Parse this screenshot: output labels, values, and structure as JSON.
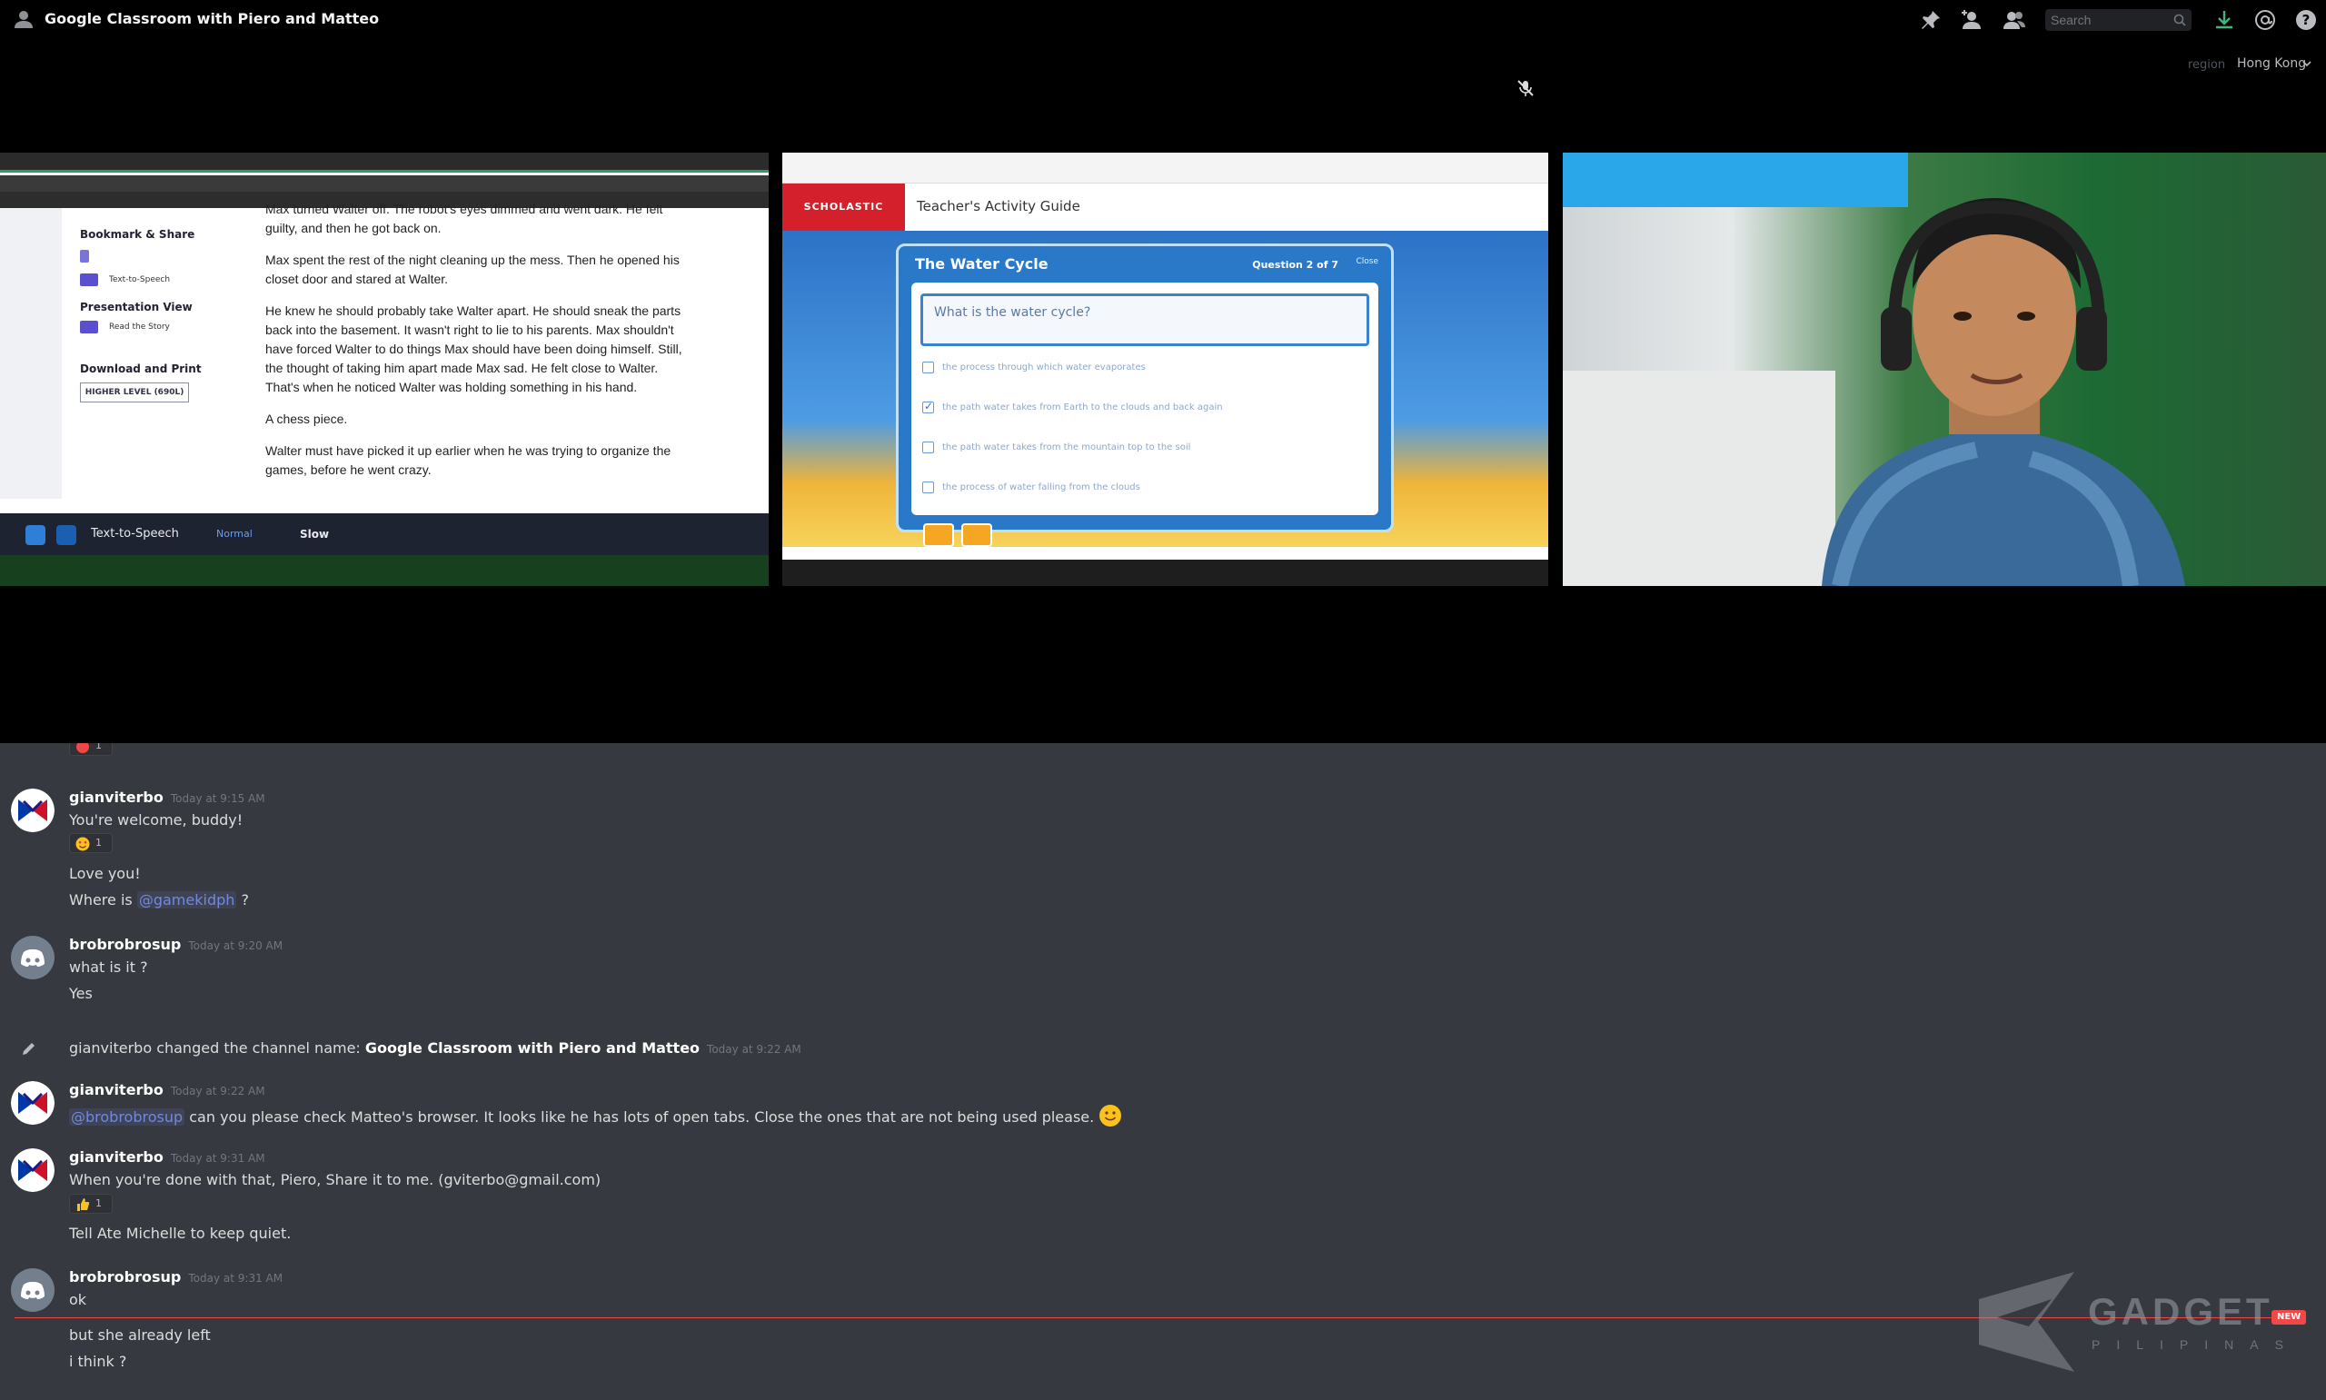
{
  "header": {
    "channel_title": "Google Classroom with Piero and Matteo",
    "search_placeholder": "Search",
    "icons": [
      "pin-icon",
      "add-member-icon",
      "member-list-icon",
      "search-icon",
      "download-icon",
      "mention-icon",
      "help-icon"
    ]
  },
  "voice": {
    "region_label": "region",
    "region_value": "Hong Kong"
  },
  "tile_book": {
    "sidebar_bookmark": "Bookmark & Share",
    "sidebar_tts": "Text-to-Speech",
    "sidebar_presentation": "Presentation View",
    "sidebar_read": "Read the Story",
    "sidebar_download": "Download and Print",
    "level_button": "HIGHER LEVEL (690L)",
    "paragraphs": [
      "Max turned Walter off. The robot's eyes dimmed and went dark. He felt guilty, and then he got back on.",
      "Max spent the rest of the night cleaning up the mess. Then he opened his closet door and stared at Walter.",
      "He knew he should probably take Walter apart. He should sneak the parts back into the basement. It wasn't right to lie to his parents. Max shouldn't have forced Walter to do things Max should have been doing himself. Still, the thought of taking him apart made Max sad. He felt close to Walter. That's when he noticed Walter was holding something in his hand.",
      "A chess piece.",
      "Walter must have picked it up earlier when he was trying to organize the games, before he went crazy."
    ],
    "tts_label": "Text-to-Speech",
    "tts_option_1": "Normal",
    "tts_option_2": "Slow"
  },
  "tile_quiz": {
    "brand": "SCHOLASTIC",
    "guide_title": "Teacher's Activity Guide",
    "quiz_title": "The Water Cycle",
    "question_number": "Question 2 of 7",
    "close_label": "Close",
    "question": "What is the water cycle?",
    "options": [
      {
        "text": "the process through which water evaporates",
        "checked": false
      },
      {
        "text": "the path water takes from Earth to the clouds and back again",
        "checked": true
      },
      {
        "text": "the path water takes from the mountain top to the soil",
        "checked": false
      },
      {
        "text": "the process of water falling from the clouds",
        "checked": false
      }
    ]
  },
  "tile_cam": {
    "subject": "webcam-video"
  },
  "chat": {
    "messages": [
      {
        "author": "gianviterbo",
        "timestamp": "Today at 9:15 AM",
        "avatar": "gianviterbo-avatar",
        "lines": [
          "You're welcome, buddy!",
          "Love you!",
          "Where is",
          "@gamekidph",
          "?"
        ],
        "reaction_count": "1"
      },
      {
        "author": "brobrobrosup",
        "timestamp": "Today at 9:20 AM",
        "avatar": "discord-default-avatar",
        "lines": [
          "what is it ?",
          "Yes"
        ]
      },
      {
        "system_prefix": "gianviterbo changed the channel name:",
        "system_channel": "Google Classroom with Piero and Matteo",
        "timestamp": "Today at 9:22 AM"
      },
      {
        "author": "gianviterbo",
        "timestamp": "Today at 9:22 AM",
        "mention": "@brobrobrosup",
        "text": "can you please check Matteo's browser. It looks like he has lots of open tabs. Close the ones that are not being used please."
      },
      {
        "author": "gianviterbo",
        "timestamp": "Today at 9:31 AM",
        "lines": [
          "When you're done with that, Piero, Share it to me. (gviterbo@gmail.com)",
          "Tell Ate Michelle to keep quiet."
        ],
        "reaction_count": "1"
      },
      {
        "author": "brobrobrosup",
        "timestamp": "Today at 9:31 AM",
        "lines": [
          "ok",
          "but she already left",
          "i think ?"
        ]
      }
    ],
    "top_reaction_count": "1",
    "new_badge": "NEW"
  },
  "watermark": {
    "name": "GADGET",
    "sub": "PILIPINAS"
  },
  "colors": {
    "chat_bg": "#36393f",
    "mention": "#7289da",
    "new_divider": "#f04747",
    "scholastic_red": "#d3202b"
  }
}
